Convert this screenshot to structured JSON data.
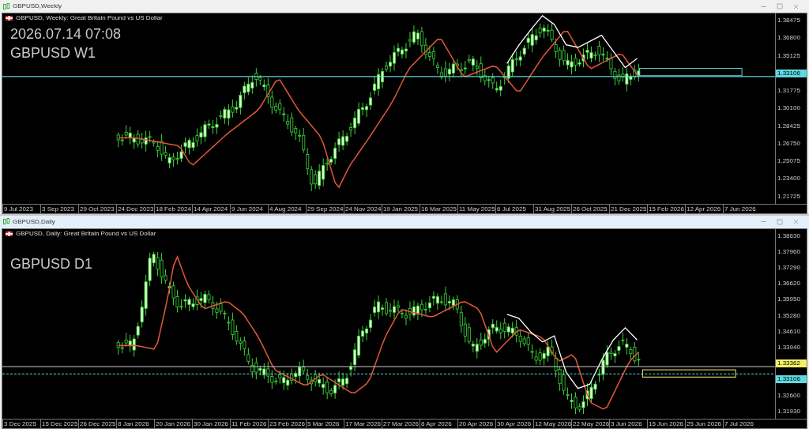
{
  "windows": [
    {
      "title": "GBPUSD,Weekly",
      "active": false,
      "header": "GBPUSD, Weekly:  Great Britain Pound vs US Dollar",
      "overlay_lines": [
        "2026.07.14 07:08",
        "GBPUSD W1"
      ],
      "price_axis": [
        {
          "kind": "tick",
          "text": "1.38475"
        },
        {
          "kind": "tick",
          "text": "1.36800"
        },
        {
          "kind": "tick",
          "text": "1.35125"
        },
        {
          "kind": "tag",
          "text": "1.33106",
          "color": "#5fd8e0"
        },
        {
          "kind": "tick",
          "text": "1.31775"
        },
        {
          "kind": "tick",
          "text": "1.30100"
        },
        {
          "kind": "tick",
          "text": "1.28425"
        },
        {
          "kind": "tick",
          "text": "1.26750"
        },
        {
          "kind": "tick",
          "text": "1.25075"
        },
        {
          "kind": "tick",
          "text": "1.23400"
        },
        {
          "kind": "tick",
          "text": "1.21725"
        }
      ],
      "time_labels": [
        "9 Jul 2023",
        "3 Sep 2023",
        "29 Oct 2023",
        "24 Dec 2023",
        "18 Feb 2024",
        "14 Apr 2024",
        "9 Jun 2024",
        "4 Aug 2024",
        "29 Sep 2024",
        "24 Nov 2024",
        "19 Jan 2025",
        "16 Mar 2025",
        "11 May 2025",
        "6 Jul 2025",
        "31 Aug 2025",
        "26 Oct 2025",
        "21 Dec 2025",
        "15 Feb 2026",
        "12 Apr 2026",
        "7 Jun 2026"
      ]
    },
    {
      "title": "GBPUSD,Daily",
      "active": true,
      "header": "GBPUSD, Daily:  Great Britain Pound vs US Dollar",
      "overlay_lines": [
        "GBPUSD D1"
      ],
      "price_axis": [
        {
          "kind": "tick",
          "text": "1.38630"
        },
        {
          "kind": "tick",
          "text": "1.37960"
        },
        {
          "kind": "tick",
          "text": "1.37290"
        },
        {
          "kind": "tick",
          "text": "1.36620"
        },
        {
          "kind": "tick",
          "text": "1.35950"
        },
        {
          "kind": "tick",
          "text": "1.35280"
        },
        {
          "kind": "tick",
          "text": "1.34610"
        },
        {
          "kind": "tick",
          "text": "1.33940"
        },
        {
          "kind": "tag",
          "text": "1.33362",
          "color": "#f5f06a"
        },
        {
          "kind": "tag",
          "text": "1.33106",
          "color": "#5fd8e0"
        },
        {
          "kind": "tick",
          "text": "1.32600"
        },
        {
          "kind": "tick",
          "text": "1.31930"
        }
      ],
      "time_labels": [
        "3 Dec 2025",
        "15 Dec 2025",
        "26 Dec 2025",
        "8 Jan 2026",
        "20 Jan 2026",
        "30 Jan 2026",
        "11 Feb 2026",
        "23 Feb 2026",
        "5 Mar 2026",
        "17 Mar 2026",
        "27 Mar 2026",
        "8 Apr 2026",
        "20 Apr 2026",
        "30 Apr 2026",
        "12 May 2026",
        "22 May 2026",
        "3 Jun 2026",
        "15 Jun 2026",
        "25 Jun 2026",
        "7 Jul 2026"
      ]
    }
  ]
}
